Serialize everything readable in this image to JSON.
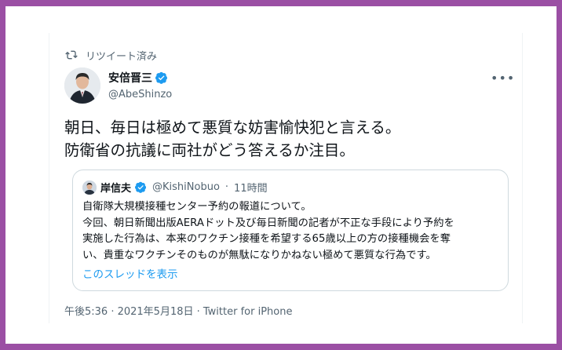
{
  "retweet": {
    "label": "リツイート済み"
  },
  "author": {
    "name": "安倍晋三",
    "handle": "@AbeShinzo"
  },
  "more_icon": "more-horizontal-icon",
  "tweet_text": {
    "line1": "朝日、毎日は極めて悪質な妨害愉快犯と言える。",
    "line2": "防衛省の抗議に両社がどう答えるか注目。"
  },
  "quote": {
    "name": "岸信夫",
    "handle": "@KishiNobuo",
    "separator": "·",
    "time": "11時間",
    "lines": [
      "自衛隊大規模接種センター予約の報道について。",
      "今回、朝日新聞出版AERAドット及び毎日新聞の記者が不正な手段により予約を",
      "実施した行為は、本来のワクチン接種を希望する65歳以上の方の接種機会を奪",
      "い、貴重なワクチンそのものが無駄になりかねない極めて悪質な行為です。"
    ],
    "thread_link": "このスレッドを表示"
  },
  "timestamp": "午後5:36 · 2021年5月18日 · Twitter for iPhone",
  "colors": {
    "accent": "#1d9bf0",
    "border": "#9b4fa4",
    "muted": "#536471"
  }
}
